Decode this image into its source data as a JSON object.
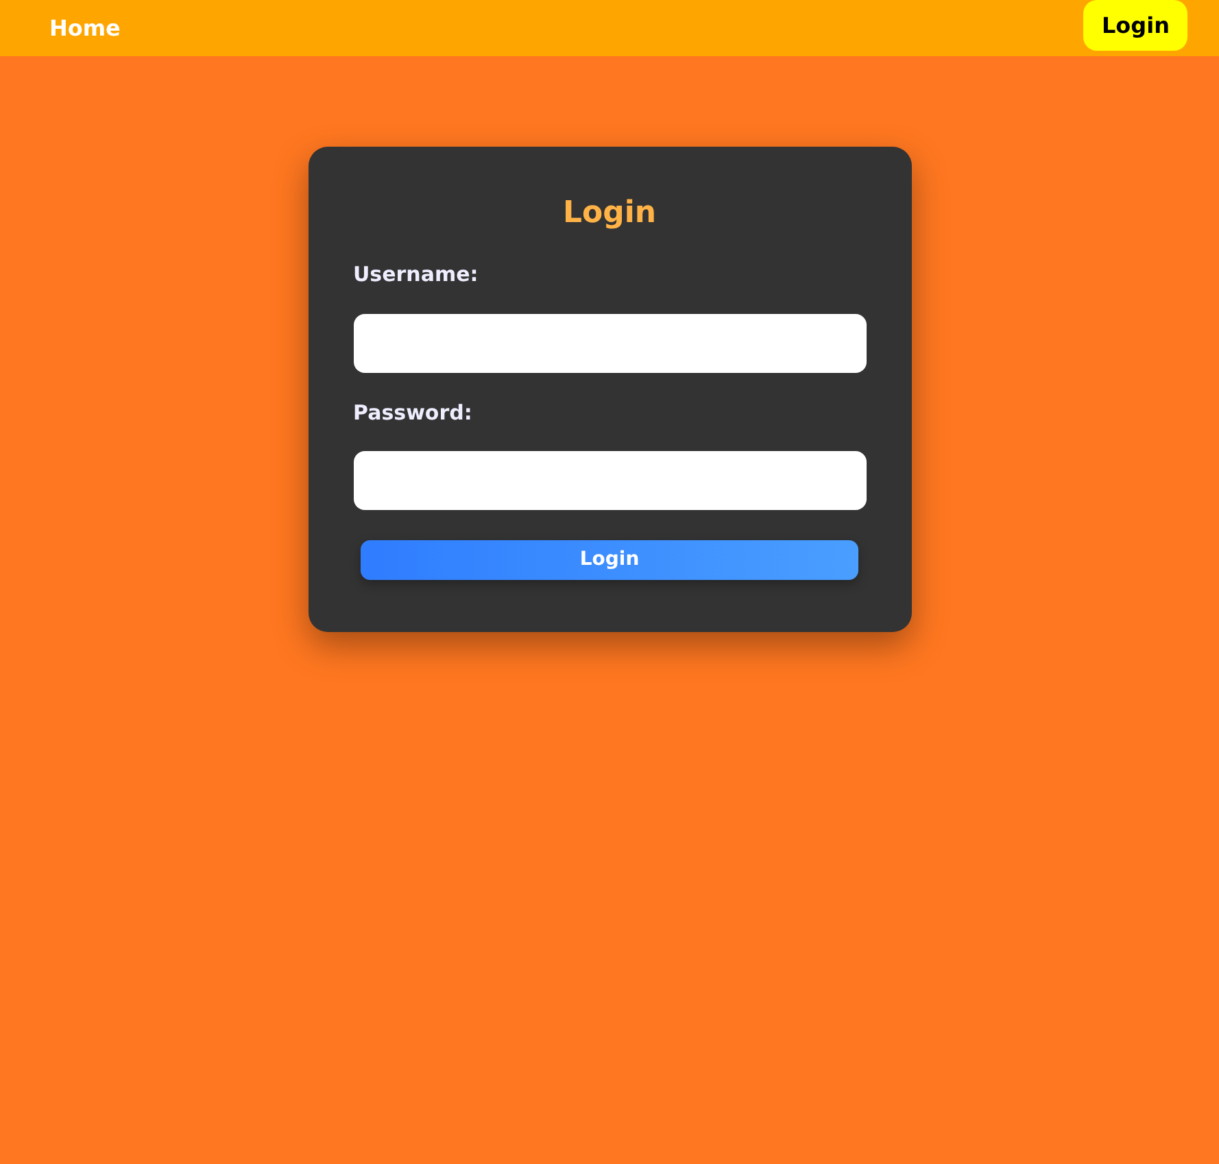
{
  "navbar": {
    "home_link": "Home",
    "login_button": "Login"
  },
  "login_form": {
    "title": "Login",
    "fields": [
      {
        "label": "Username:"
      },
      {
        "label": "Password:"
      }
    ],
    "submit_button": "Login"
  }
}
